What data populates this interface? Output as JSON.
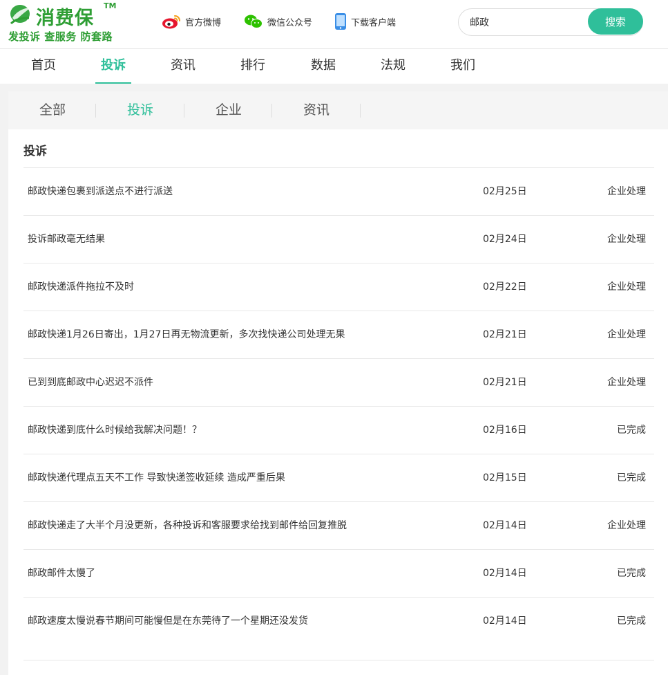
{
  "brand": {
    "name": "消费保",
    "tm": "TM",
    "slogan": "发投诉 查服务 防套路",
    "color": "#2e9e34"
  },
  "top_links": [
    {
      "label": "官方微博",
      "icon": "weibo-icon"
    },
    {
      "label": "微信公众号",
      "icon": "wechat-icon"
    },
    {
      "label": "下载客户端",
      "icon": "mobile-phone-icon"
    }
  ],
  "search": {
    "value": "邮政",
    "button": "搜索"
  },
  "main_nav": [
    "首页",
    "投诉",
    "资讯",
    "排行",
    "数据",
    "法规",
    "我们"
  ],
  "main_nav_active": "投诉",
  "sub_tabs": [
    "全部",
    "投诉",
    "企业",
    "资讯"
  ],
  "sub_tab_active": "投诉",
  "section_title": "投诉",
  "complaints": [
    {
      "title": "邮政快递包裹到派送点不进行派送",
      "date": "02月25日",
      "status": "企业处理"
    },
    {
      "title": "投诉邮政毫无结果",
      "date": "02月24日",
      "status": "企业处理"
    },
    {
      "title": "邮政快递派件拖拉不及时",
      "date": "02月22日",
      "status": "企业处理"
    },
    {
      "title": "邮政快递1月26日寄出，1月27日再无物流更新，多次找快递公司处理无果",
      "date": "02月21日",
      "status": "企业处理"
    },
    {
      "title": "已到到底邮政中心迟迟不派件",
      "date": "02月21日",
      "status": "企业处理"
    },
    {
      "title": "邮政快递到底什么时候给我解决问题！？",
      "date": "02月16日",
      "status": "已完成"
    },
    {
      "title": "邮政快递代理点五天不工作 导致快递签收延续 造成严重后果",
      "date": "02月15日",
      "status": "已完成"
    },
    {
      "title": "邮政快递走了大半个月没更新，各种投诉和客服要求给找到邮件给回复推脱",
      "date": "02月14日",
      "status": "企业处理"
    },
    {
      "title": "邮政邮件太慢了",
      "date": "02月14日",
      "status": "已完成"
    },
    {
      "title": "邮政速度太慢说春节期间可能慢但是在东莞待了一个星期还没发货",
      "date": "02月14日",
      "status": "已完成"
    }
  ],
  "colors": {
    "accent": "#2fbf9a",
    "brand_green": "#2e9e34"
  }
}
